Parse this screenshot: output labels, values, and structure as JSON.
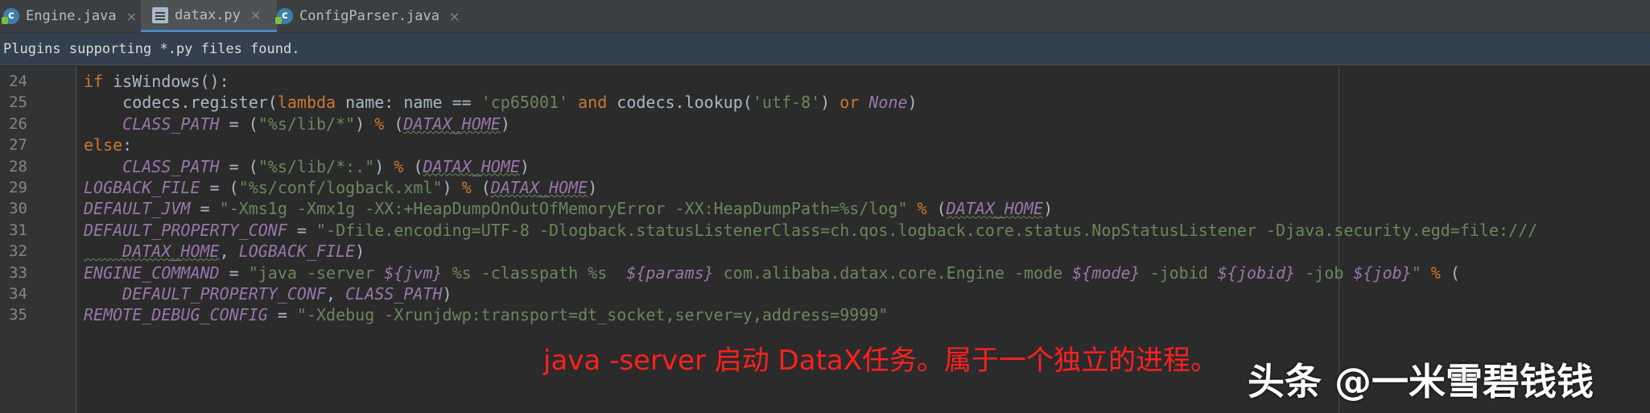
{
  "tabs": [
    {
      "label": "Engine.java",
      "icon": "java-class-icon",
      "active": false
    },
    {
      "label": "datax.py",
      "icon": "python-file-icon",
      "active": true
    },
    {
      "label": "ConfigParser.java",
      "icon": "java-class-icon",
      "active": false
    }
  ],
  "tab_close_glyph": "×",
  "notification": "Plugins supporting *.py files found.",
  "lines": [
    {
      "n": "24",
      "tokens": [
        [
          "kw",
          "if "
        ],
        [
          "fn",
          "isWindows():"
        ]
      ]
    },
    {
      "n": "25",
      "tokens": [
        [
          "fn",
          "    codecs.register("
        ],
        [
          "kw",
          "lambda "
        ],
        [
          "fn",
          "name: name == "
        ],
        [
          "st",
          "'cp65001' "
        ],
        [
          "kw",
          "and "
        ],
        [
          "fn",
          "codecs.lookup("
        ],
        [
          "st",
          "'utf-8'"
        ],
        [
          "fn",
          ") "
        ],
        [
          "kw",
          "or "
        ],
        [
          "cn",
          "None"
        ],
        [
          "fn",
          ")"
        ]
      ]
    },
    {
      "n": "26",
      "tokens": [
        [
          "cn",
          "    CLASS_PATH"
        ],
        [
          "fn",
          " = ("
        ],
        [
          "st",
          "\"%s/lib/*\""
        ],
        [
          "fn",
          ") "
        ],
        [
          "kw",
          "% "
        ],
        [
          "fn",
          "("
        ],
        [
          "cnw",
          "DATAX_HOME"
        ],
        [
          "fn",
          ")"
        ]
      ]
    },
    {
      "n": "27",
      "tokens": [
        [
          "kw",
          "else"
        ],
        [
          "fn",
          ":"
        ]
      ]
    },
    {
      "n": "28",
      "tokens": [
        [
          "cn",
          "    CLASS_PATH"
        ],
        [
          "fn",
          " = ("
        ],
        [
          "st",
          "\"%s/lib/*:.\""
        ],
        [
          "fn",
          ") "
        ],
        [
          "kw",
          "% "
        ],
        [
          "fn",
          "("
        ],
        [
          "cnw",
          "DATAX_HOME"
        ],
        [
          "fn",
          ")"
        ]
      ]
    },
    {
      "n": "29",
      "tokens": [
        [
          "cn",
          "LOGBACK_FILE"
        ],
        [
          "fn",
          " = ("
        ],
        [
          "st",
          "\"%s/conf/logback.xml\""
        ],
        [
          "fn",
          ") "
        ],
        [
          "kw",
          "% "
        ],
        [
          "fn",
          "("
        ],
        [
          "cnw",
          "DATAX_HOME"
        ],
        [
          "fn",
          ")"
        ]
      ]
    },
    {
      "n": "30",
      "tokens": [
        [
          "cn",
          "DEFAULT_JVM"
        ],
        [
          "fn",
          " = "
        ],
        [
          "st",
          "\"-Xms1g -Xmx1g -XX:+HeapDumpOnOutOfMemoryError -XX:HeapDumpPath=%s/log\" "
        ],
        [
          "kw",
          "% "
        ],
        [
          "fn",
          "("
        ],
        [
          "cnw",
          "DATAX_HOME"
        ],
        [
          "fn",
          ")"
        ]
      ]
    },
    {
      "n": "31",
      "tokens": [
        [
          "cn",
          "DEFAULT_PROPERTY_CONF"
        ],
        [
          "fn",
          " = "
        ],
        [
          "st",
          "\"-Dfile.encoding=UTF-8 -Dlogback.statusListenerClass=ch.qos.logback.core.status.NopStatusListener -Djava.security.egd=file:///"
        ]
      ]
    },
    {
      "n": "32",
      "tokens": [
        [
          "cnw",
          "    DATAX_HOME"
        ],
        [
          "fn",
          ", "
        ],
        [
          "cn",
          "LOGBACK_FILE"
        ],
        [
          "fn",
          ")"
        ]
      ]
    },
    {
      "n": "33",
      "tokens": [
        [
          "cn",
          "ENGINE_COMMAND"
        ],
        [
          "fn",
          " = "
        ],
        [
          "st",
          "\"java -server "
        ],
        [
          "cn",
          "${jvm} "
        ],
        [
          "st",
          "%s -classpath %s  "
        ],
        [
          "cn",
          "${params} "
        ],
        [
          "st",
          "com.alibaba.datax.core.Engine -mode "
        ],
        [
          "cn",
          "${mode} "
        ],
        [
          "st",
          "-jobid "
        ],
        [
          "cn",
          "${jobid} "
        ],
        [
          "st",
          "-job "
        ],
        [
          "cn",
          "${job}"
        ],
        [
          "st",
          "\" "
        ],
        [
          "kw",
          "% "
        ],
        [
          "fn",
          "("
        ]
      ]
    },
    {
      "n": "34",
      "tokens": [
        [
          "cn",
          "    DEFAULT_PROPERTY_CONF"
        ],
        [
          "fn",
          ", "
        ],
        [
          "cn",
          "CLASS_PATH"
        ],
        [
          "fn",
          ")"
        ]
      ]
    },
    {
      "n": "35",
      "tokens": [
        [
          "cn",
          "REMOTE_DEBUG_CONFIG"
        ],
        [
          "fn",
          " = "
        ],
        [
          "st",
          "\"-Xdebug -Xrunjdwp:transport=dt_socket,server=y,address=9999\""
        ]
      ]
    }
  ],
  "annotation": "java -server 启动 DataX任务。属于一个独立的进程。",
  "watermark": "头条 @一米雪碧钱钱"
}
